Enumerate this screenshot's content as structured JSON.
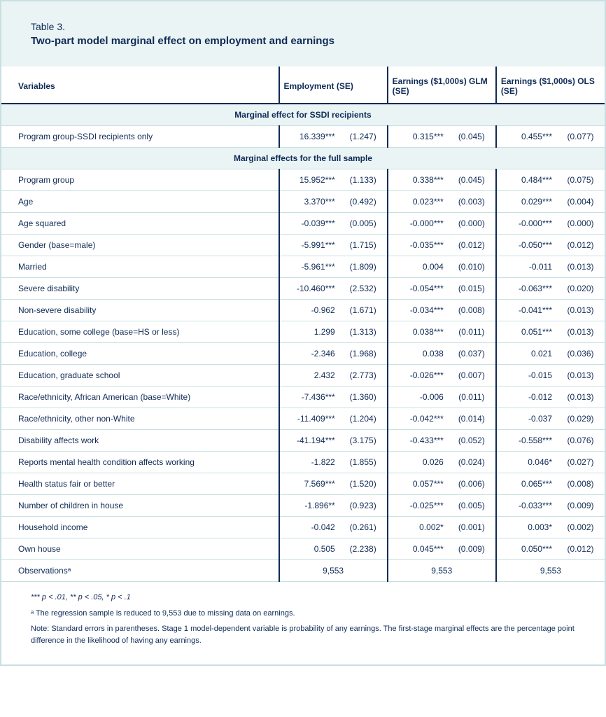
{
  "header": {
    "table_num": "Table 3.",
    "title": "Two-part model marginal effect on employment and earnings"
  },
  "columns": {
    "var_label": "Variables",
    "col1": "Employment (SE)",
    "col2": "Earnings ($1,000s) GLM (SE)",
    "col3": "Earnings ($1,000s) OLS (SE)"
  },
  "sections": [
    {
      "title": "Marginal effect for SSDI recipients",
      "rows": [
        {
          "label": "Program group-SSDI recipients only",
          "c1v": "16.339***",
          "c1s": "(1.247)",
          "c2v": "0.315***",
          "c2s": "(0.045)",
          "c3v": "0.455***",
          "c3s": "(0.077)"
        }
      ]
    },
    {
      "title": "Marginal effects for the full sample",
      "rows": [
        {
          "label": "Program group",
          "c1v": "15.952***",
          "c1s": "(1.133)",
          "c2v": "0.338***",
          "c2s": "(0.045)",
          "c3v": "0.484***",
          "c3s": "(0.075)"
        },
        {
          "label": "Age",
          "c1v": "3.370***",
          "c1s": "(0.492)",
          "c2v": "0.023***",
          "c2s": "(0.003)",
          "c3v": "0.029***",
          "c3s": "(0.004)"
        },
        {
          "label": "Age squared",
          "c1v": "-0.039***",
          "c1s": "(0.005)",
          "c2v": "-0.000***",
          "c2s": "(0.000)",
          "c3v": "-0.000***",
          "c3s": "(0.000)"
        },
        {
          "label": "Gender (base=male)",
          "c1v": "-5.991***",
          "c1s": "(1.715)",
          "c2v": "-0.035***",
          "c2s": "(0.012)",
          "c3v": "-0.050***",
          "c3s": "(0.012)"
        },
        {
          "label": "Married",
          "c1v": "-5.961***",
          "c1s": "(1.809)",
          "c2v": "0.004",
          "c2s": "(0.010)",
          "c3v": "-0.011",
          "c3s": "(0.013)"
        },
        {
          "label": "Severe disability",
          "c1v": "-10.460***",
          "c1s": "(2.532)",
          "c2v": "-0.054***",
          "c2s": "(0.015)",
          "c3v": "-0.063***",
          "c3s": "(0.020)"
        },
        {
          "label": "Non-severe disability",
          "c1v": "-0.962",
          "c1s": "(1.671)",
          "c2v": "-0.034***",
          "c2s": "(0.008)",
          "c3v": "-0.041***",
          "c3s": "(0.013)"
        },
        {
          "label": "Education, some college (base=HS or less)",
          "c1v": "1.299",
          "c1s": "(1.313)",
          "c2v": "0.038***",
          "c2s": "(0.011)",
          "c3v": "0.051***",
          "c3s": "(0.013)"
        },
        {
          "label": "Education, college",
          "c1v": "-2.346",
          "c1s": "(1.968)",
          "c2v": "0.038",
          "c2s": "(0.037)",
          "c3v": "0.021",
          "c3s": "(0.036)"
        },
        {
          "label": "Education, graduate school",
          "c1v": "2.432",
          "c1s": "(2.773)",
          "c2v": "-0.026***",
          "c2s": "(0.007)",
          "c3v": "-0.015",
          "c3s": "(0.013)"
        },
        {
          "label": "Race/ethnicity, African American (base=White)",
          "c1v": "-7.436***",
          "c1s": "(1.360)",
          "c2v": "-0.006",
          "c2s": "(0.011)",
          "c3v": "-0.012",
          "c3s": "(0.013)"
        },
        {
          "label": "Race/ethnicity, other non-White",
          "c1v": "-11.409***",
          "c1s": "(1.204)",
          "c2v": "-0.042***",
          "c2s": "(0.014)",
          "c3v": "-0.037",
          "c3s": "(0.029)"
        },
        {
          "label": "Disability affects work",
          "c1v": "-41.194***",
          "c1s": "(3.175)",
          "c2v": "-0.433***",
          "c2s": "(0.052)",
          "c3v": "-0.558***",
          "c3s": "(0.076)"
        },
        {
          "label": "Reports mental health condition affects working",
          "c1v": "-1.822",
          "c1s": "(1.855)",
          "c2v": "0.026",
          "c2s": "(0.024)",
          "c3v": "0.046*",
          "c3s": "(0.027)"
        },
        {
          "label": "Health status fair or better",
          "c1v": "7.569***",
          "c1s": "(1.520)",
          "c2v": "0.057***",
          "c2s": "(0.006)",
          "c3v": "0.065***",
          "c3s": "(0.008)"
        },
        {
          "label": "Number of children in house",
          "c1v": "-1.896**",
          "c1s": "(0.923)",
          "c2v": "-0.025***",
          "c2s": "(0.005)",
          "c3v": "-0.033***",
          "c3s": "(0.009)"
        },
        {
          "label": "Household income",
          "c1v": "-0.042",
          "c1s": "(0.261)",
          "c2v": "0.002*",
          "c2s": "(0.001)",
          "c3v": "0.003*",
          "c3s": "(0.002)"
        },
        {
          "label": "Own house",
          "c1v": "0.505",
          "c1s": "(2.238)",
          "c2v": "0.045***",
          "c2s": "(0.009)",
          "c3v": "0.050***",
          "c3s": "(0.012)"
        }
      ]
    }
  ],
  "observations": {
    "label": "Observationsᵃ",
    "c1": "9,553",
    "c2": "9,553",
    "c3": "9,553"
  },
  "footnotes": {
    "sig": "*** p < .01, ** p < .05, * p < .1",
    "a": "ᵃ The regression sample is reduced to 9,553 due to missing data on earnings.",
    "note": "Note: Standard errors in parentheses. Stage 1 model-dependent variable is probability of any earnings. The first-stage marginal effects are the percentage point difference in the likelihood of having any earnings."
  }
}
